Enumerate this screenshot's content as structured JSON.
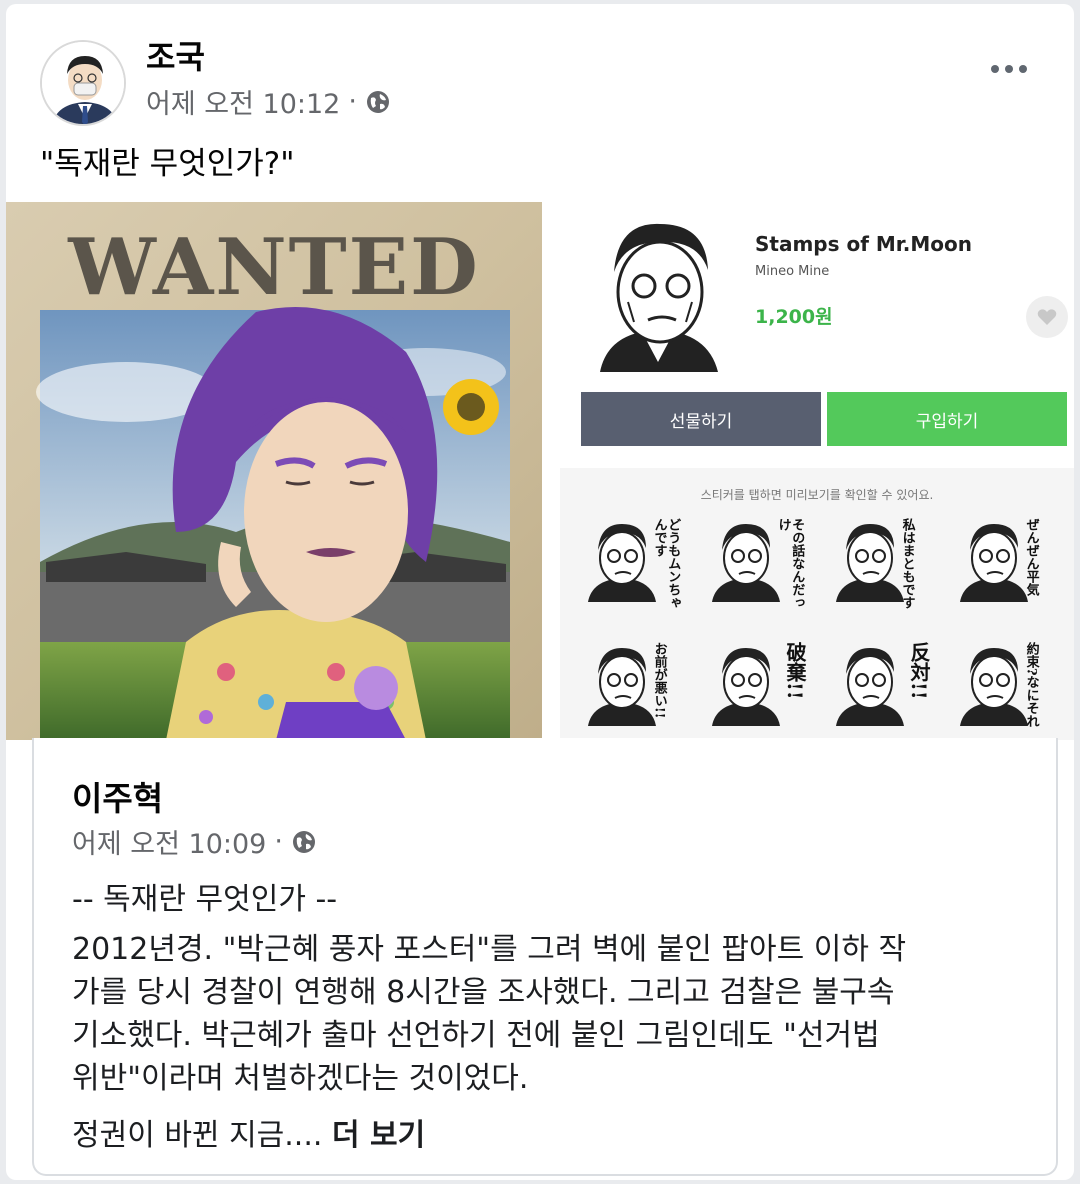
{
  "post": {
    "author": "조국",
    "time": "어제 오전 10:12",
    "separator": "·",
    "caption": "\"독재란 무엇인가?\""
  },
  "poster": {
    "headline": "WANTED"
  },
  "shop": {
    "title": "Stamps of Mr.Moon",
    "author": "Mineo Mine",
    "price": "1,200원",
    "gift_label": "선물하기",
    "buy_label": "구입하기",
    "preview_hint": "스티커를 탭하면 미리보기를 확인할 수 있어요.",
    "stickers": [
      {
        "text": "どうもムンちゃんです"
      },
      {
        "text": "その話なんだっけ"
      },
      {
        "text": "私はまともです"
      },
      {
        "text": "ぜんぜん平気"
      },
      {
        "text": "お前が悪い!!"
      },
      {
        "text": "破棄!!"
      },
      {
        "text": "反対!!"
      },
      {
        "text": "約束?なにそれ"
      }
    ]
  },
  "shared": {
    "author": "이주혁",
    "time": "어제 오전 10:09",
    "separator": "·",
    "title": "-- 독재란 무엇인가 --",
    "body_lines": [
      "2012년경. \"박근혜 풍자 포스터\"를 그려 벽에 붙인 팝아트 이하 작",
      "가를 당시 경찰이 연행해 8시간을 조사했다. 그리고 검찰은 불구속",
      "기소했다. 박근혜가 출마 선언하기 전에 붙인 그림인데도 \"선거법",
      "위반\"이라며 처벌하겠다는 것이었다."
    ],
    "more_text": "정권이 바뀐 지금....",
    "more_link": "더 보기"
  },
  "colors": {
    "name_gray": "#65676b",
    "buy_green": "#53c95b",
    "gift_gray": "#585f70",
    "price_green": "#3cb44a"
  }
}
